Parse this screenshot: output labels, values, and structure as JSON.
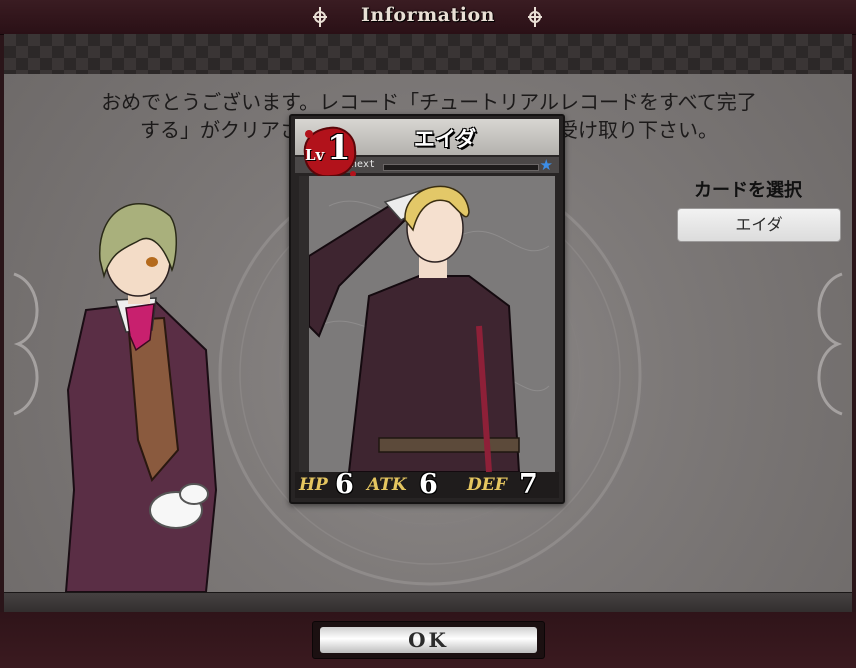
{
  "header": {
    "title": "Information"
  },
  "message": {
    "line1": "おめでとうございます。レコード「チュートリアルレコードをすべて完了",
    "line2": "する」がクリアされました。記念アイテムをお受け取り下さい。"
  },
  "card": {
    "name": "エイダ",
    "level_label": "Lv",
    "level": "1",
    "next_label": "next",
    "exp_progress": 0.0,
    "stats": {
      "hp_label": "HP",
      "hp": "6",
      "atk_label": "ATK",
      "atk": "6",
      "def_label": "DEF",
      "def": "7"
    }
  },
  "select": {
    "label": "カードを選択",
    "value": "エイダ"
  },
  "footer": {
    "ok_label": "OK"
  },
  "colors": {
    "header_bg": "#2a1016",
    "panel_bg": "#7d7978",
    "stat_label": "#e5c660",
    "rarity_star": "#3c8de6",
    "level_badge": "#b2121b"
  },
  "icons": {
    "header_ornament": "fleur-ornament-icon",
    "rarity": "star-icon"
  }
}
